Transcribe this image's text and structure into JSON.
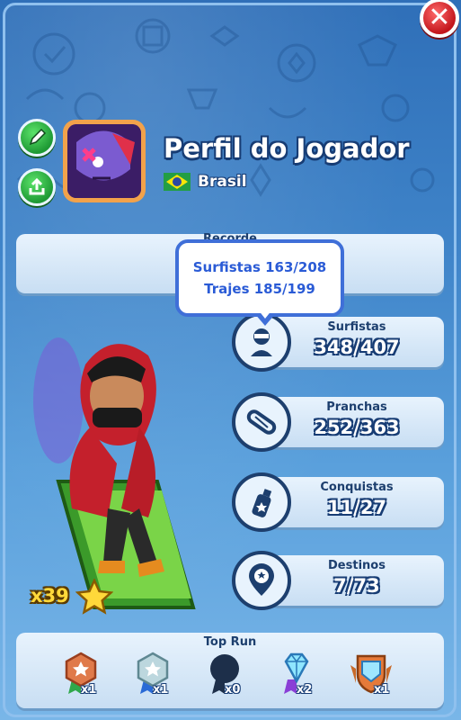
{
  "header": {
    "title": "Perfil do Jogador",
    "country": "Brasil"
  },
  "record": {
    "label": "Recorde"
  },
  "tooltip": {
    "surfers_line": "Surfistas 163/208",
    "outfits_line": "Trajes 185/199"
  },
  "stats": [
    {
      "label": "Surfistas",
      "value": "348/407",
      "icon": "surfer-icon"
    },
    {
      "label": "Pranchas",
      "value": "252/363",
      "icon": "board-icon"
    },
    {
      "label": "Conquistas",
      "value": "11/27",
      "icon": "spray-can-icon"
    },
    {
      "label": "Destinos",
      "value": "7/73",
      "icon": "location-pin-icon"
    }
  ],
  "character": {
    "multiplier": "x39"
  },
  "top_run": {
    "title": "Top Run",
    "medals": [
      {
        "name": "bronze-medal-icon",
        "count": "x1"
      },
      {
        "name": "silver-medal-icon",
        "count": "x1"
      },
      {
        "name": "dark-medal-icon",
        "count": "x0"
      },
      {
        "name": "diamond-medal-icon",
        "count": "x2"
      },
      {
        "name": "crystal-shield-icon",
        "count": "x1"
      }
    ]
  },
  "colors": {
    "accent_blue": "#3f6fd8",
    "dark_outline": "#173c74",
    "close_red": "#c3161c",
    "button_green": "#1e9a34",
    "multiplier_yellow": "#ffd83a"
  }
}
